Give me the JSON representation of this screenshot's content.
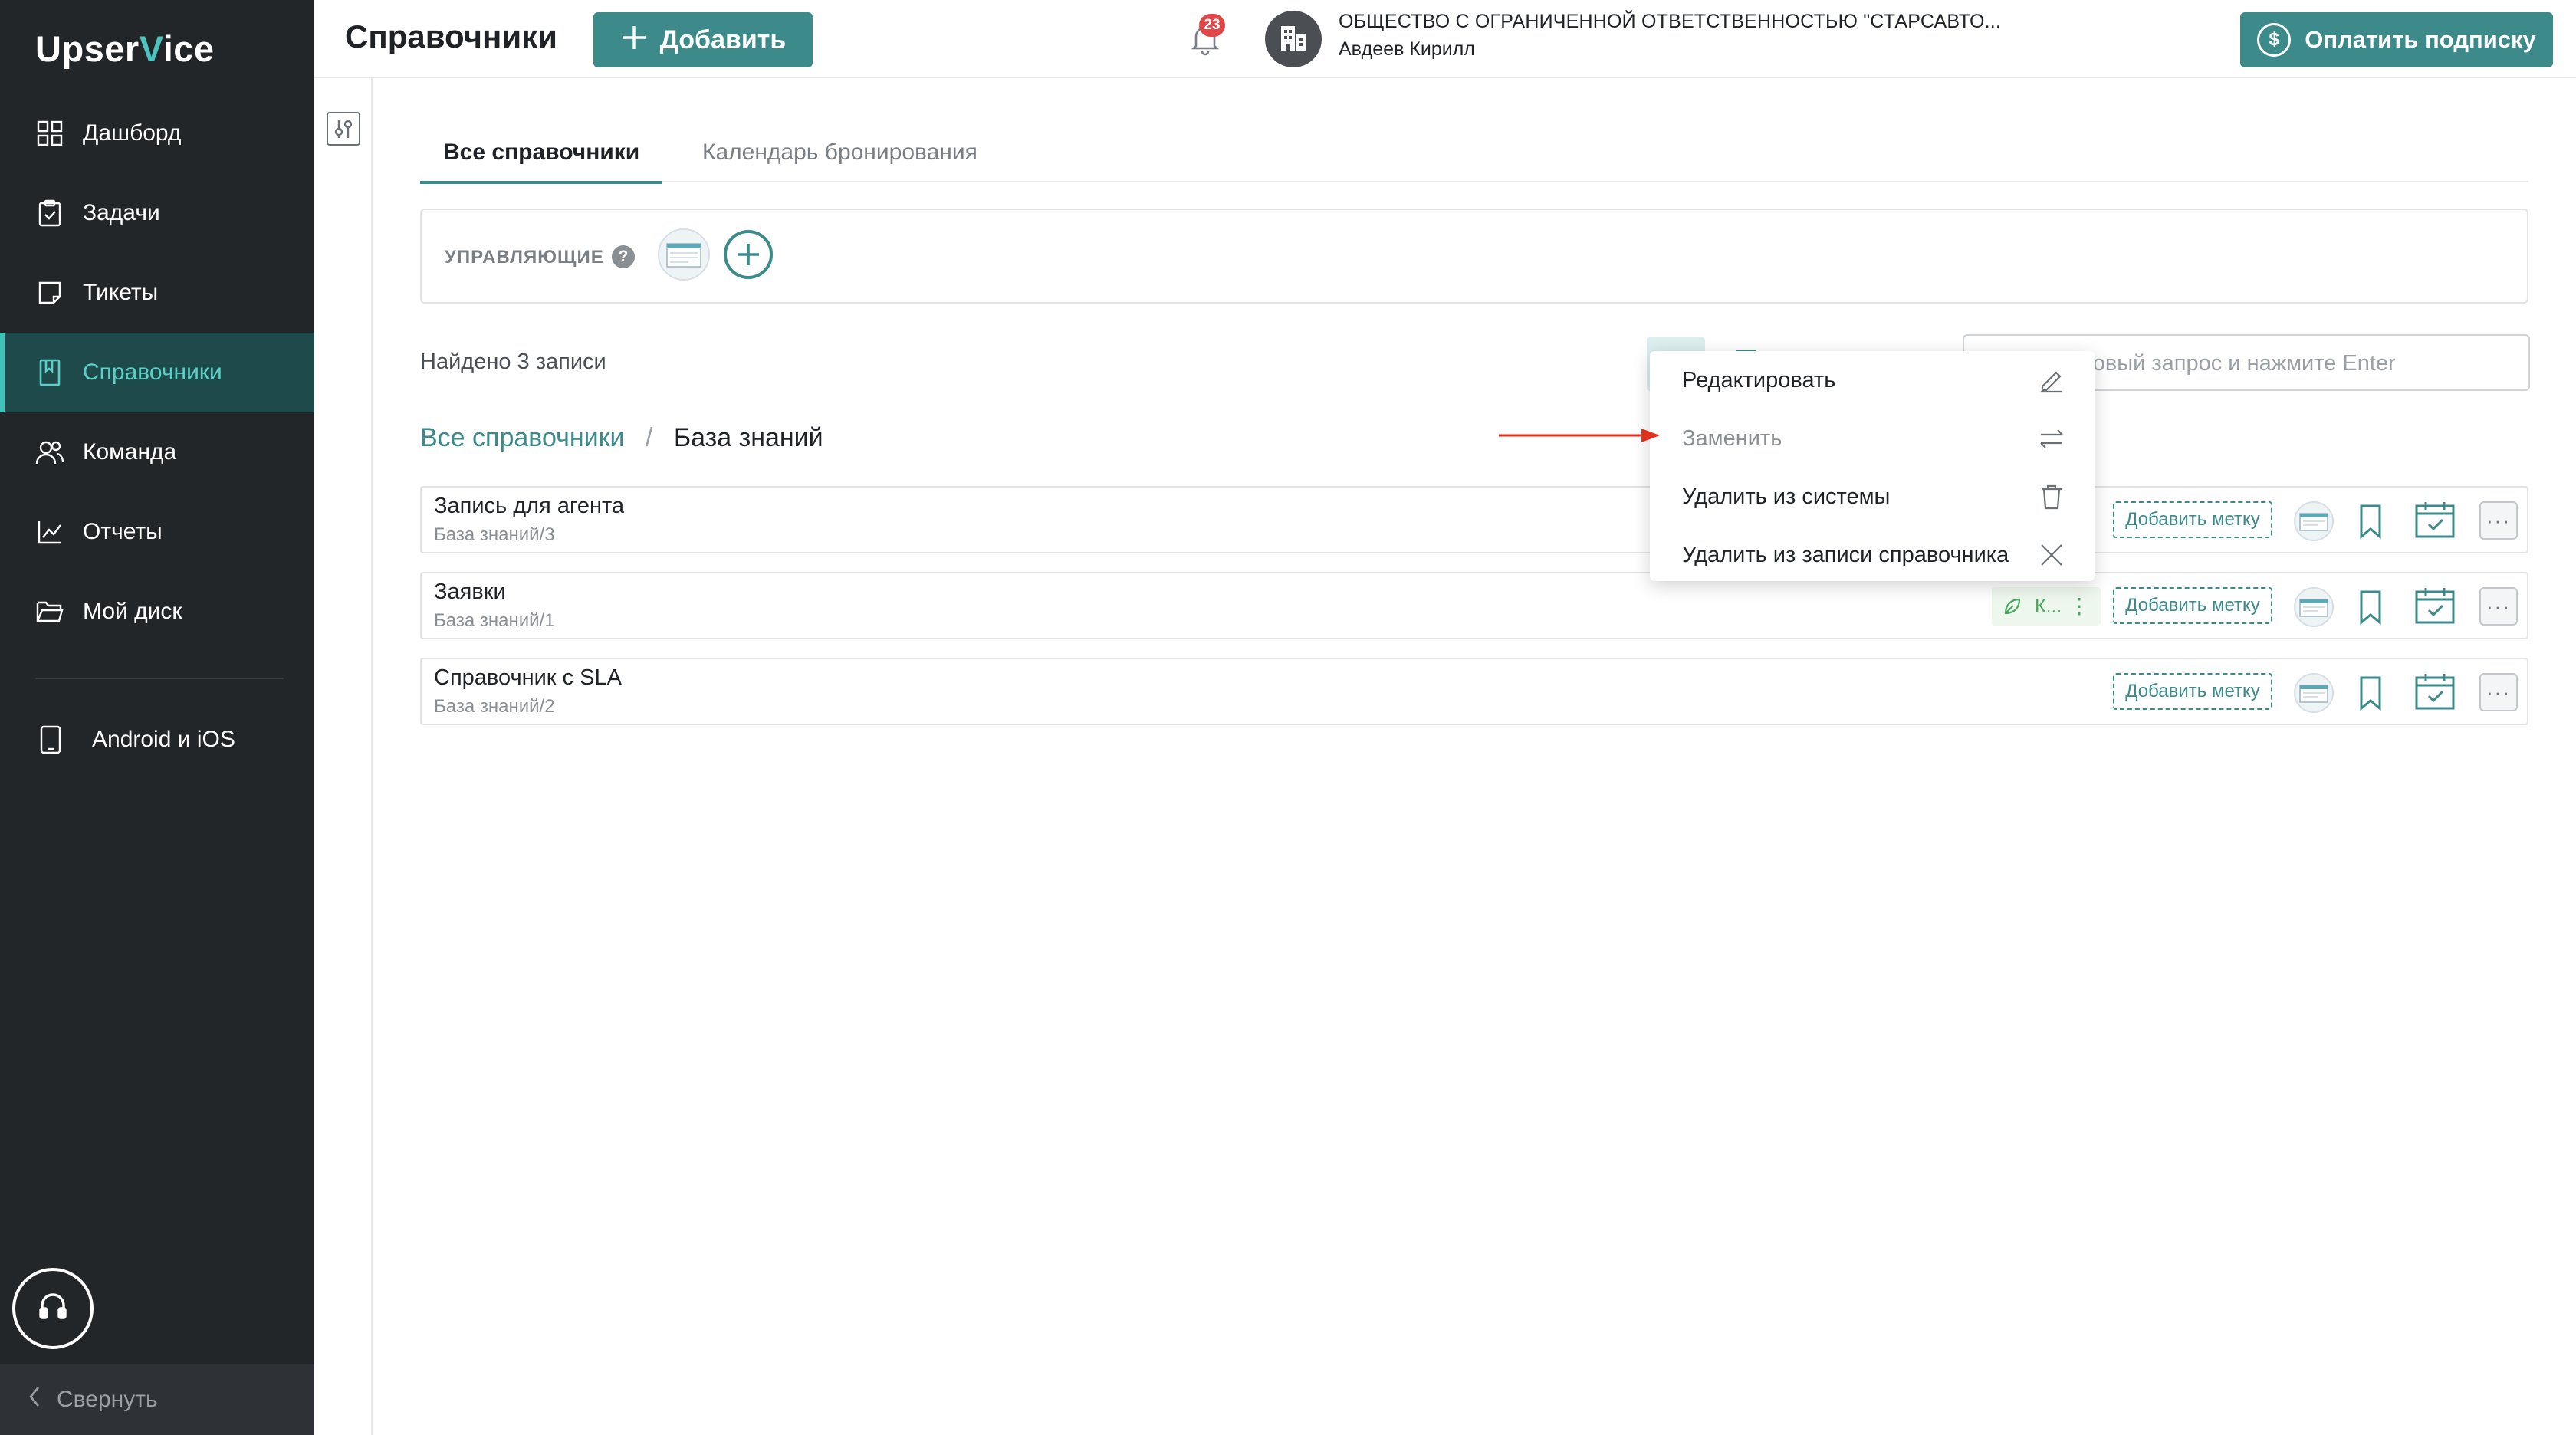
{
  "app": {
    "logo_prefix": "Upser",
    "logo_v": "V",
    "logo_suffix": "ice"
  },
  "sidebar": {
    "items": [
      {
        "label": "Дашборд",
        "icon": "dashboard-icon"
      },
      {
        "label": "Задачи",
        "icon": "tasks-icon"
      },
      {
        "label": "Тикеты",
        "icon": "tickets-icon"
      },
      {
        "label": "Справочники",
        "icon": "directory-icon",
        "active": true
      },
      {
        "label": "Команда",
        "icon": "team-icon"
      },
      {
        "label": "Отчеты",
        "icon": "reports-icon"
      },
      {
        "label": "Мой диск",
        "icon": "folder-icon"
      }
    ],
    "mobile_label": "Android и iOS",
    "collapse_label": "Свернуть"
  },
  "header": {
    "title": "Справочники",
    "add_label": "Добавить",
    "notifications_count": "23",
    "org_name": "ОБЩЕСТВО С ОГРАНИЧЕННОЙ ОТВЕТСТВЕННОСТЬЮ \"СТАРСАВТО...",
    "user_name": "Авдеев Кирилл",
    "pay_label": "Оплатить подписку",
    "pay_icon_glyph": "$"
  },
  "tabs": [
    {
      "label": "Все справочники",
      "active": true
    },
    {
      "label": "Календарь бронирования",
      "active": false
    }
  ],
  "managers": {
    "label": "УПРАВЛЯЮЩИЕ",
    "help_glyph": "?",
    "add_glyph": "+"
  },
  "results": {
    "found_text": "Найдено 3 записи"
  },
  "search": {
    "placeholder": "Введите поисковый запрос и нажмите Enter",
    "visible_placeholder": "е поисковый запрос и нажмите Enter"
  },
  "breadcrumb": {
    "root": "Все справочники",
    "separator": "/",
    "current": "База знаний"
  },
  "rows": [
    {
      "title": "Запись для агента",
      "subtitle": "База знаний/3",
      "tag_label": "Добавить метку",
      "more_glyph": "···"
    },
    {
      "title": "Заявки",
      "subtitle": "База знаний/1",
      "tag_label": "Добавить метку",
      "more_glyph": "···",
      "chip_label": "К...",
      "chip_dots": "⋮"
    },
    {
      "title": "Справочник с SLA",
      "subtitle": "База знаний/2",
      "tag_label": "Добавить метку",
      "more_glyph": "···"
    }
  ],
  "context_menu": {
    "items": [
      {
        "label": "Редактировать",
        "icon": "pencil-icon",
        "disabled": false
      },
      {
        "label": "Заменить",
        "icon": "swap-icon",
        "disabled": true
      },
      {
        "label": "Удалить из системы",
        "icon": "trash-icon",
        "disabled": false
      },
      {
        "label": "Удалить из записи справочника",
        "icon": "close-icon",
        "disabled": false
      }
    ]
  },
  "colors": {
    "accent": "#3c8a8a",
    "sidebar_bg": "#232629",
    "sidebar_active": "#1e4a4c",
    "badge": "#e04848",
    "annotation_arrow": "#e0301e"
  }
}
